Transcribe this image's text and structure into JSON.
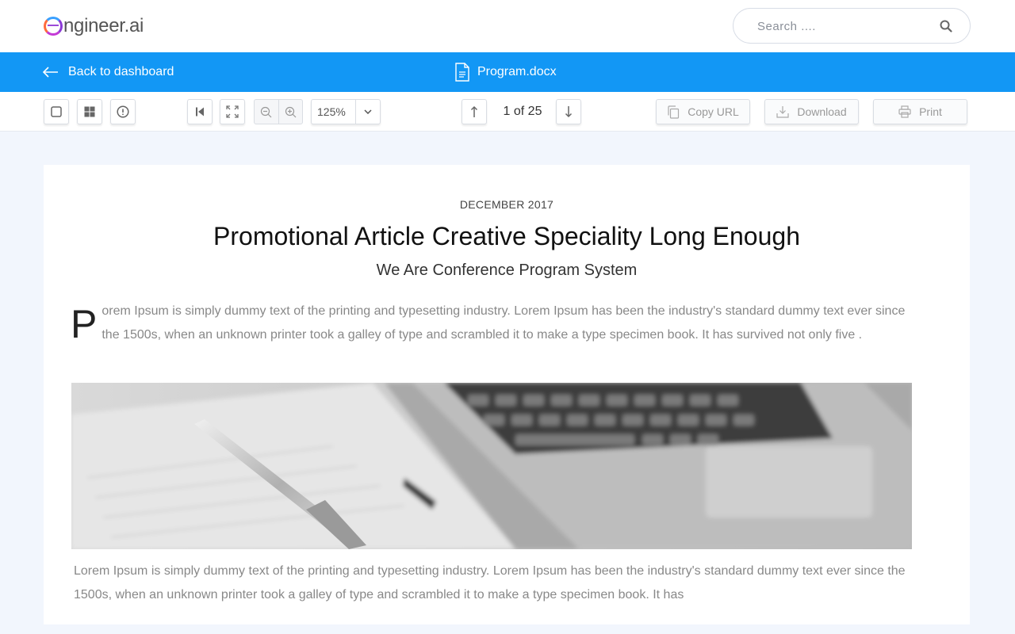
{
  "brand": {
    "logo_text": "ngineer.ai",
    "ring_colors": [
      "#3aa0ff",
      "#8b3ad6",
      "#ff6a3d"
    ]
  },
  "search": {
    "placeholder": "Search ...."
  },
  "nav": {
    "back_label": "Back to dashboard",
    "filename": "Program.docx",
    "bar_color": "#1297f5"
  },
  "toolbar": {
    "zoom": "125%",
    "page_info": "1 of 25",
    "copy_url_label": "Copy URL",
    "download_label": "Download",
    "print_label": "Print"
  },
  "document": {
    "date": "DECEMBER 2017",
    "title": "Promotional Article Creative Speciality Long Enough",
    "subtitle": "We Are Conference Program System",
    "drop_cap": "P",
    "para1": "orem Ipsum is simply dummy text of the printing and typesetting industry. Lorem Ipsum has been the industry's standard dummy text ever since the 1500s, when an unknown printer took a galley of type and scrambled it to make a type specimen book. It has survived not only five .",
    "para2": "Lorem Ipsum is simply dummy text of the printing and typesetting industry. Lorem Ipsum has been the industry's standard dummy text ever since the 1500s, when an unknown printer took a galley of type and scrambled it to make a type specimen book. It has"
  }
}
